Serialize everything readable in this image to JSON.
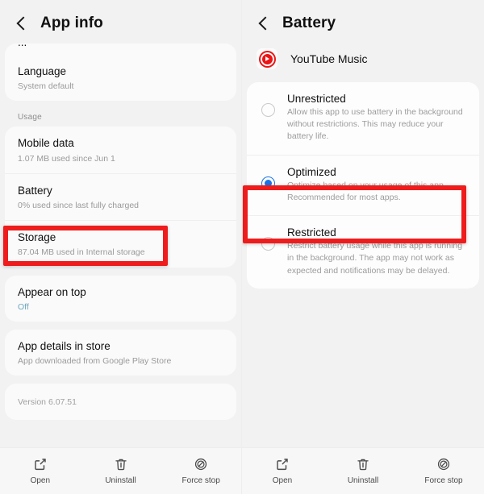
{
  "left_screen": {
    "header": {
      "title": "App info",
      "back_icon": "chevron-left-icon"
    },
    "partial_row_above": "...",
    "rows": [
      {
        "title": "Language",
        "subtitle": "System default",
        "subtitle_style": "muted"
      }
    ],
    "usage_section_label": "Usage",
    "usage_rows": [
      {
        "title": "Mobile data",
        "subtitle": "1.07 MB used since Jun 1",
        "subtitle_style": "muted"
      },
      {
        "title": "Battery",
        "subtitle": "0% used since last fully charged",
        "subtitle_style": "muted",
        "highlighted": true
      },
      {
        "title": "Storage",
        "subtitle": "87.04 MB used in Internal storage",
        "subtitle_style": "muted"
      }
    ],
    "appear_rows": [
      {
        "title": "Appear on top",
        "subtitle": "Off",
        "subtitle_style": "accent"
      }
    ],
    "store_rows": [
      {
        "title": "App details in store",
        "subtitle": "App downloaded from Google Play Store",
        "subtitle_style": "muted"
      }
    ],
    "version": "Version 6.07.51"
  },
  "right_screen": {
    "header": {
      "title": "Battery",
      "back_icon": "chevron-left-icon"
    },
    "app": {
      "name": "YouTube Music",
      "icon": "youtube-music-icon"
    },
    "options": [
      {
        "title": "Unrestricted",
        "description": "Allow this app to use battery in the background without restrictions. This may reduce your battery life.",
        "selected": false,
        "highlighted": true
      },
      {
        "title": "Optimized",
        "description": "Optimize based on your usage of this app. Recommended for most apps.",
        "selected": true,
        "highlighted": false
      },
      {
        "title": "Restricted",
        "description": "Restrict battery usage while this app is running in the background. The app may not work as expected and notifications may be delayed.",
        "selected": false,
        "highlighted": false
      }
    ]
  },
  "bottom_bar": {
    "items": [
      {
        "label": "Open",
        "icon": "external-link-icon"
      },
      {
        "label": "Uninstall",
        "icon": "trash-icon"
      },
      {
        "label": "Force stop",
        "icon": "circle-slash-icon"
      }
    ]
  },
  "colors": {
    "annotation_red": "#ee1c1c",
    "radio_selected_blue": "#1a73e8",
    "accent_link_blue": "#6fa8c0",
    "brand_red": "#ec1414",
    "screen_background": "#f2f2f2",
    "card_background": "#fafafa"
  }
}
